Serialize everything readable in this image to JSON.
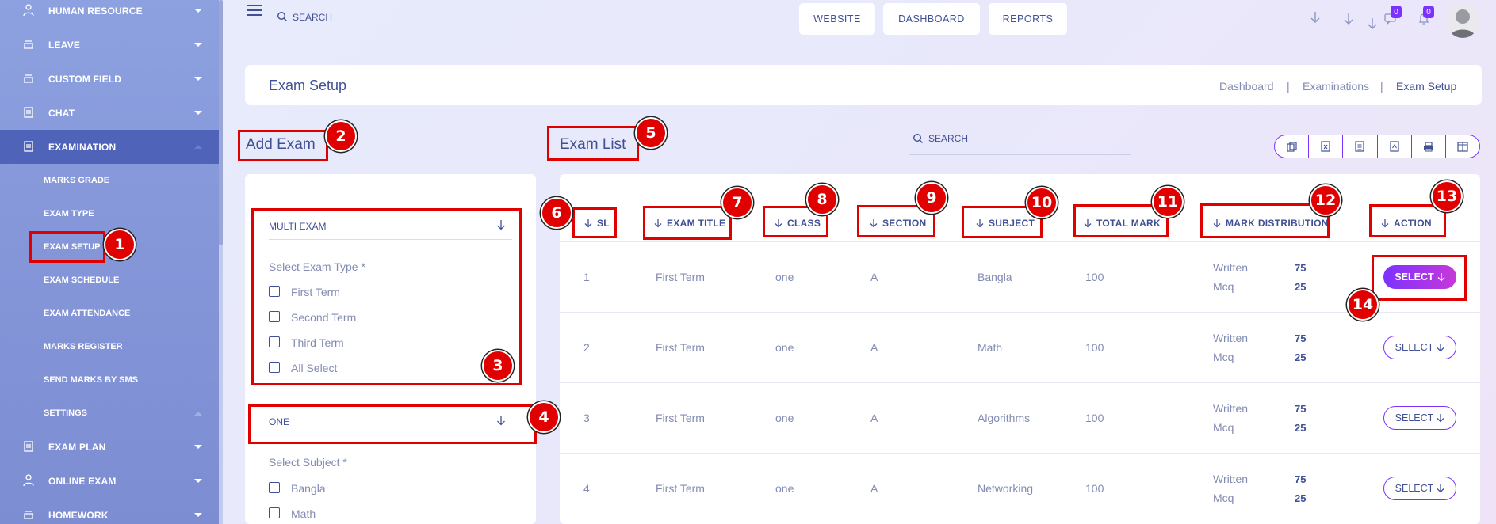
{
  "sidebar": {
    "items": [
      {
        "label": "HUMAN RESOURCE",
        "icon": "user-tie-icon"
      },
      {
        "label": "LEAVE",
        "icon": "leave-icon"
      },
      {
        "label": "CUSTOM FIELD",
        "icon": "custom-field-icon"
      },
      {
        "label": "CHAT",
        "icon": "chat-icon"
      },
      {
        "label": "EXAMINATION",
        "icon": "examination-icon",
        "active": true
      }
    ],
    "subitems": [
      "MARKS GRADE",
      "EXAM TYPE",
      "EXAM SETUP",
      "EXAM SCHEDULE",
      "EXAM ATTENDANCE",
      "MARKS REGISTER",
      "SEND MARKS BY SMS",
      "SETTINGS"
    ],
    "bottom_items": [
      {
        "label": "EXAM PLAN",
        "icon": "exam-plan-icon"
      },
      {
        "label": "ONLINE EXAM",
        "icon": "online-exam-icon"
      },
      {
        "label": "HOMEWORK",
        "icon": "homework-icon"
      }
    ]
  },
  "topbar": {
    "search_placeholder": "SEARCH",
    "buttons": [
      "WEBSITE",
      "DASHBOARD",
      "REPORTS"
    ],
    "message_count": "0",
    "notification_count": "0"
  },
  "page": {
    "title": "Exam Setup",
    "breadcrumb": [
      "Dashboard",
      "Examinations",
      "Exam Setup"
    ],
    "breadcrumb_separator": "|"
  },
  "add_exam": {
    "title": "Add Exam",
    "exam_dropdown": "MULTI EXAM",
    "exam_type_label": "Select Exam Type *",
    "exam_types": [
      "First Term",
      "Second Term",
      "Third Term",
      "All Select"
    ],
    "class_dropdown": "ONE",
    "subject_label": "Select Subject *",
    "subjects": [
      "Bangla",
      "Math"
    ]
  },
  "exam_list": {
    "title": "Exam List",
    "search_placeholder": "SEARCH",
    "columns": [
      "SL",
      "EXAM TITLE",
      "CLASS",
      "SECTION",
      "SUBJECT",
      "TOTAL MARK",
      "MARK DISTRIBUTION",
      "ACTION"
    ],
    "rows": [
      {
        "sl": "1",
        "title": "First Term",
        "class": "one",
        "section": "A",
        "subject": "Bangla",
        "total": "100",
        "dist": [
          [
            "Written",
            "75"
          ],
          [
            "Mcq",
            "25"
          ]
        ],
        "action": "SELECT"
      },
      {
        "sl": "2",
        "title": "First Term",
        "class": "one",
        "section": "A",
        "subject": "Math",
        "total": "100",
        "dist": [
          [
            "Written",
            "75"
          ],
          [
            "Mcq",
            "25"
          ]
        ],
        "action": "SELECT"
      },
      {
        "sl": "3",
        "title": "First Term",
        "class": "one",
        "section": "A",
        "subject": "Algorithms",
        "total": "100",
        "dist": [
          [
            "Written",
            "75"
          ],
          [
            "Mcq",
            "25"
          ]
        ],
        "action": "SELECT"
      },
      {
        "sl": "4",
        "title": "First Term",
        "class": "one",
        "section": "A",
        "subject": "Networking",
        "total": "100",
        "dist": [
          [
            "Written",
            "75"
          ],
          [
            "Mcq",
            "25"
          ]
        ],
        "action": "SELECT"
      }
    ]
  },
  "annotations": [
    "1",
    "2",
    "3",
    "4",
    "5",
    "6",
    "7",
    "8",
    "9",
    "10",
    "11",
    "12",
    "13",
    "14"
  ],
  "colors": {
    "accent": "#7c32ff",
    "annotation": "#e00000",
    "text": "#415094",
    "sidebar_active": "#4f63b8"
  }
}
